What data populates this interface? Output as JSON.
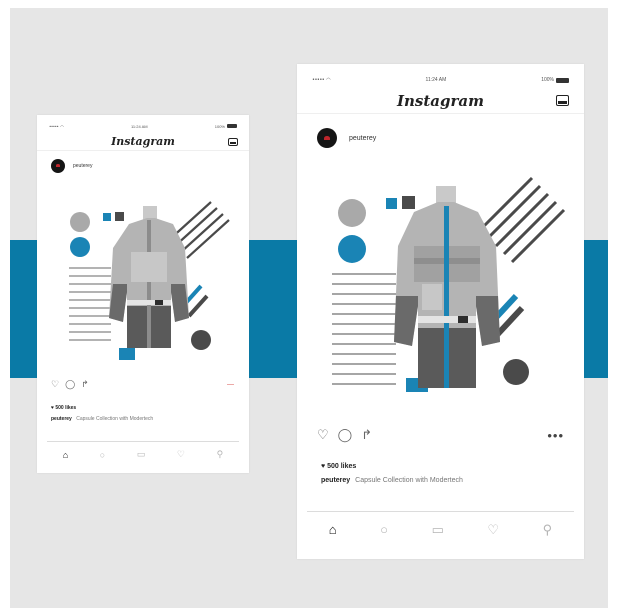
{
  "colors": {
    "panel": "#e6e6e6",
    "band": "#0a7aa6",
    "accent_blue": "#1a84b5",
    "shape_gray": "#a9a9a9",
    "dark_gray": "#4a4a4a"
  },
  "small": {
    "status": {
      "carrier": "•••••",
      "time": "11:24 AM",
      "battery": "100%"
    },
    "app_title": "Instagram",
    "username": "peuterey",
    "likes": "♥ 500 likes",
    "caption": {
      "user": "peuterey",
      "text": "Capsule Collection with Modertech"
    }
  },
  "large": {
    "status": {
      "carrier": "•••••",
      "time": "11:24 AM",
      "battery": "100%"
    },
    "app_title": "Instagram",
    "username": "peuterey",
    "likes": "♥ 500 likes",
    "caption": {
      "user": "peuterey",
      "text": "Capsule Collection with Modertech"
    },
    "more": "•••"
  },
  "icons": {
    "like": "heart-icon",
    "comment": "comment-icon",
    "share": "share-icon",
    "inbox": "inbox-icon",
    "home": "home-icon",
    "search": "search-icon",
    "camera": "camera-icon",
    "activity": "heart-icon",
    "profile": "profile-icon"
  }
}
